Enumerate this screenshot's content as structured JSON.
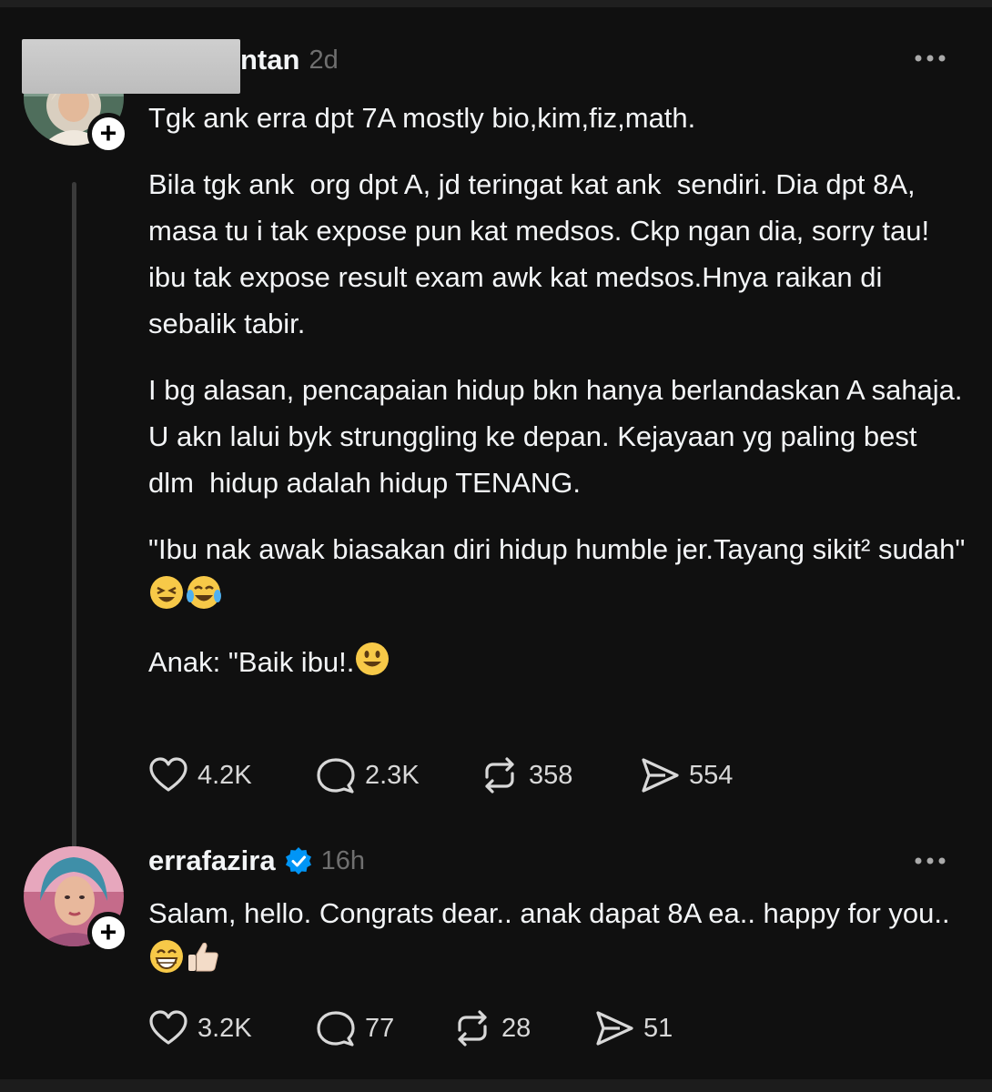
{
  "posts": [
    {
      "username": "ntan",
      "time": "2d",
      "paragraphs": [
        "Tgk ank erra dpt 7A mostly bio,kim,fiz,math.",
        "Bila tgk ank  org dpt A, jd teringat kat ank  sendiri. Dia dpt 8A, masa tu i tak expose pun kat medsos. Ckp ngan dia, sorry tau! ibu tak expose result exam awk kat medsos.Hnya raikan di sebalik tabir.",
        "I bg alasan, pencapaian hidup bkn hanya berlandaskan A sahaja. U akn lalui byk strunggling ke depan. Kejayaan yg paling best dlm  hidup adalah hidup TENANG.",
        "\"Ibu nak awak biasakan diri hidup humble jer.Tayang sikit² sudah\"",
        "Anak: \"Baik ibu!."
      ],
      "likes": "4.2K",
      "replies": "2.3K",
      "reposts": "358",
      "shares": "554"
    },
    {
      "username": "errafazira",
      "time": "16h",
      "verified": true,
      "paragraphs": [
        "Salam, hello. Congrats dear.. anak dapat 8A ea.. happy for you.."
      ],
      "likes": "3.2K",
      "replies": "77",
      "reposts": "28",
      "shares": "51"
    }
  ],
  "icons": {
    "like": "heart-icon",
    "reply": "speech-bubble-icon",
    "repost": "repost-icon",
    "share": "send-icon",
    "more": "more-dots-icon",
    "follow": "plus-icon",
    "verified": "verified-badge-icon"
  },
  "colors": {
    "background": "#101010",
    "text": "#f3f5f7",
    "muted": "#6f6f6f",
    "verified": "#0095f6"
  }
}
